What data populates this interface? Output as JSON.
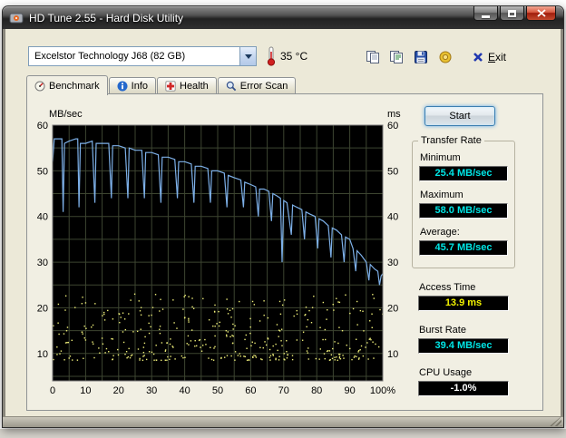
{
  "window": {
    "title": "HD Tune 2.55 - Hard Disk Utility"
  },
  "toolbar": {
    "drive_selector_value": "Excelstor Technology J68 (82 GB)",
    "temperature": "35 °C",
    "exit_label": "Exit",
    "icons": [
      "thermometer-icon",
      "copy-screenshot-icon",
      "copy-text-icon",
      "save-icon",
      "options-icon",
      "exit-icon",
      "chevron-down-icon"
    ]
  },
  "tabs": [
    {
      "label": "Benchmark",
      "icon": "benchmark-icon",
      "active": true
    },
    {
      "label": "Info",
      "icon": "info-icon",
      "active": false
    },
    {
      "label": "Health",
      "icon": "health-icon",
      "active": false
    },
    {
      "label": "Error Scan",
      "icon": "error-scan-icon",
      "active": false
    }
  ],
  "results": {
    "start_label": "Start",
    "transfer_rate_title": "Transfer Rate",
    "minimum_label": "Minimum",
    "minimum_value": "25.4 MB/sec",
    "maximum_label": "Maximum",
    "maximum_value": "58.0 MB/sec",
    "average_label": "Average:",
    "average_value": "45.7 MB/sec",
    "access_time_label": "Access Time",
    "access_time_value": "13.9 ms",
    "burst_rate_label": "Burst Rate",
    "burst_rate_value": "39.4 MB/sec",
    "cpu_usage_label": "CPU Usage",
    "cpu_usage_value": "-1.0%",
    "value_colors": {
      "transfer": "#00e6e6",
      "access": "#f2f200",
      "cpu": "#ffffff"
    }
  },
  "chart_data": {
    "type": "line+scatter",
    "plot_bg": "#000000",
    "grid_color": "#3d4531",
    "border_color": "#7a7a7a",
    "x_axis": {
      "range": [
        0,
        100
      ],
      "grid_step": 5,
      "tick_values": [
        0,
        10,
        20,
        30,
        40,
        50,
        60,
        70,
        80,
        90,
        100
      ],
      "tick_labels": [
        "0",
        "10",
        "20",
        "30",
        "40",
        "50",
        "60",
        "70",
        "80",
        "90",
        "100%"
      ]
    },
    "y_axis_left": {
      "label": "MB/sec",
      "range": [
        4,
        60
      ],
      "grid_step": 5,
      "ticks": [
        60,
        50,
        40,
        30,
        20,
        10
      ]
    },
    "y_axis_right": {
      "label": "ms",
      "ticks": [
        60,
        50,
        40,
        30,
        20,
        10
      ]
    },
    "series": [
      {
        "name": "Transfer Rate",
        "type": "line",
        "color": "#7db0e8",
        "points": [
          [
            0,
            52
          ],
          [
            0.5,
            57
          ],
          [
            2,
            57
          ],
          [
            2.8,
            57
          ],
          [
            3.2,
            41
          ],
          [
            3.6,
            56
          ],
          [
            5,
            56.5
          ],
          [
            7,
            57
          ],
          [
            7.6,
            57
          ],
          [
            8,
            42
          ],
          [
            8.4,
            56
          ],
          [
            10,
            56
          ],
          [
            12,
            56.5
          ],
          [
            12.8,
            43
          ],
          [
            13.2,
            56
          ],
          [
            15,
            56
          ],
          [
            17,
            56
          ],
          [
            17.8,
            44
          ],
          [
            18.2,
            55.5
          ],
          [
            20,
            55.5
          ],
          [
            22,
            55
          ],
          [
            22.8,
            44
          ],
          [
            23.2,
            55
          ],
          [
            25,
            54.5
          ],
          [
            27,
            54.5
          ],
          [
            27.8,
            44
          ],
          [
            28.2,
            54
          ],
          [
            30,
            54
          ],
          [
            32,
            53.5
          ],
          [
            32.8,
            43
          ],
          [
            33.2,
            53
          ],
          [
            35,
            53
          ],
          [
            37,
            52.5
          ],
          [
            37.8,
            44
          ],
          [
            38.2,
            52
          ],
          [
            40,
            52
          ],
          [
            42,
            51.5
          ],
          [
            42.8,
            43
          ],
          [
            43.2,
            51
          ],
          [
            45,
            51
          ],
          [
            47,
            50.5
          ],
          [
            47.8,
            43
          ],
          [
            48.2,
            50
          ],
          [
            50,
            50
          ],
          [
            52,
            49.5
          ],
          [
            52.8,
            42
          ],
          [
            53.2,
            49
          ],
          [
            55,
            48.5
          ],
          [
            57,
            48
          ],
          [
            57.8,
            42
          ],
          [
            58.2,
            47.5
          ],
          [
            60,
            47
          ],
          [
            61.5,
            46.5
          ],
          [
            62.3,
            40
          ],
          [
            62.7,
            46
          ],
          [
            64,
            46
          ],
          [
            65.5,
            45.5
          ],
          [
            66.3,
            39
          ],
          [
            66.7,
            45
          ],
          [
            68,
            44.5
          ],
          [
            69,
            44
          ],
          [
            69.5,
            30
          ],
          [
            70,
            43.5
          ],
          [
            71,
            43
          ],
          [
            72.3,
            36
          ],
          [
            72.7,
            42.5
          ],
          [
            74,
            42
          ],
          [
            75.5,
            41.5
          ],
          [
            76.3,
            35
          ],
          [
            76.7,
            41
          ],
          [
            78,
            40.5
          ],
          [
            79.5,
            40
          ],
          [
            80.3,
            33
          ],
          [
            80.7,
            39.5
          ],
          [
            82,
            39
          ],
          [
            83.5,
            38
          ],
          [
            84.3,
            31
          ],
          [
            84.7,
            37.5
          ],
          [
            86,
            37
          ],
          [
            87.5,
            36
          ],
          [
            88.3,
            30
          ],
          [
            88.7,
            35.5
          ],
          [
            90,
            35
          ],
          [
            91,
            33
          ],
          [
            91.8,
            28
          ],
          [
            92.2,
            32.5
          ],
          [
            93.5,
            31.5
          ],
          [
            95,
            30
          ],
          [
            95.8,
            26
          ],
          [
            96.2,
            29.5
          ],
          [
            97.5,
            28.5
          ],
          [
            98.5,
            28
          ],
          [
            99,
            25
          ],
          [
            99.5,
            27
          ],
          [
            100,
            27.5
          ]
        ]
      },
      {
        "name": "Access Time",
        "type": "scatter",
        "color": "#f0f07a",
        "count": 380,
        "y_min": 8.5,
        "y_max": 23,
        "seed": 1337,
        "skew": 1.6
      }
    ]
  }
}
